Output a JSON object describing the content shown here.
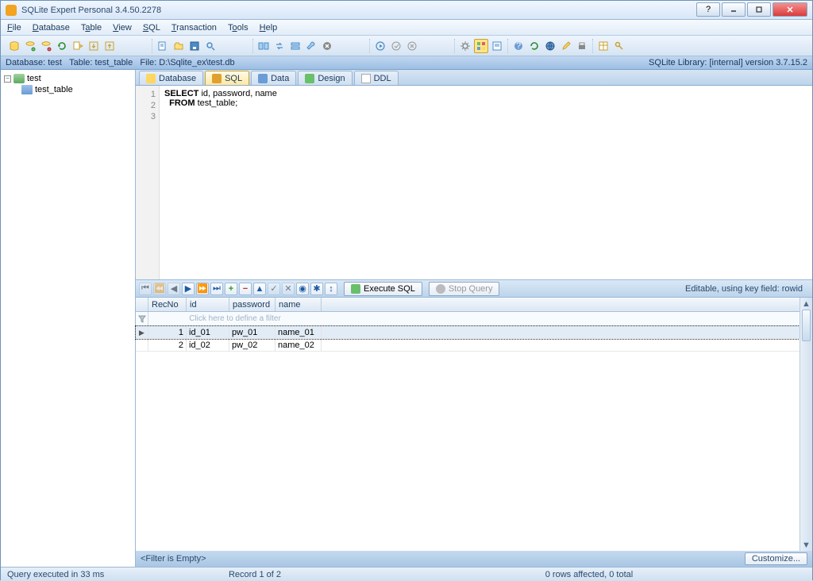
{
  "title": "SQLite Expert Personal 3.4.50.2278",
  "menu": [
    "File",
    "Database",
    "Table",
    "View",
    "SQL",
    "Transaction",
    "Tools",
    "Help"
  ],
  "status": {
    "database_label": "Database:",
    "database": "test",
    "table_label": "Table:",
    "table": "test_table",
    "file_label": "File:",
    "file": "D:\\Sqlite_ex\\test.db",
    "library": "SQLite Library: [internal] version 3.7.15.2"
  },
  "tree": {
    "db": "test",
    "table": "test_table"
  },
  "tabs": [
    "Database",
    "SQL",
    "Data",
    "Design",
    "DDL"
  ],
  "sql": {
    "line1": "SELECT id, password, name",
    "line2": "  FROM test_table;"
  },
  "grid_toolbar": {
    "execute": "Execute SQL",
    "stop": "Stop Query",
    "editable": "Editable, using key field: rowid"
  },
  "grid": {
    "headers": {
      "recno": "RecNo",
      "id": "id",
      "password": "password",
      "name": "name"
    },
    "filter_prompt": "Click here to define a filter",
    "rows": [
      {
        "recno": "1",
        "id": "id_01",
        "pw": "pw_01",
        "nm": "name_01"
      },
      {
        "recno": "2",
        "id": "id_02",
        "pw": "pw_02",
        "nm": "name_02"
      }
    ]
  },
  "filter_bar": {
    "text": "<Filter is Empty>",
    "customize": "Customize..."
  },
  "bottom": {
    "exec": "Query executed in 33 ms",
    "record": "Record 1 of 2",
    "rows": "0 rows affected, 0 total"
  }
}
